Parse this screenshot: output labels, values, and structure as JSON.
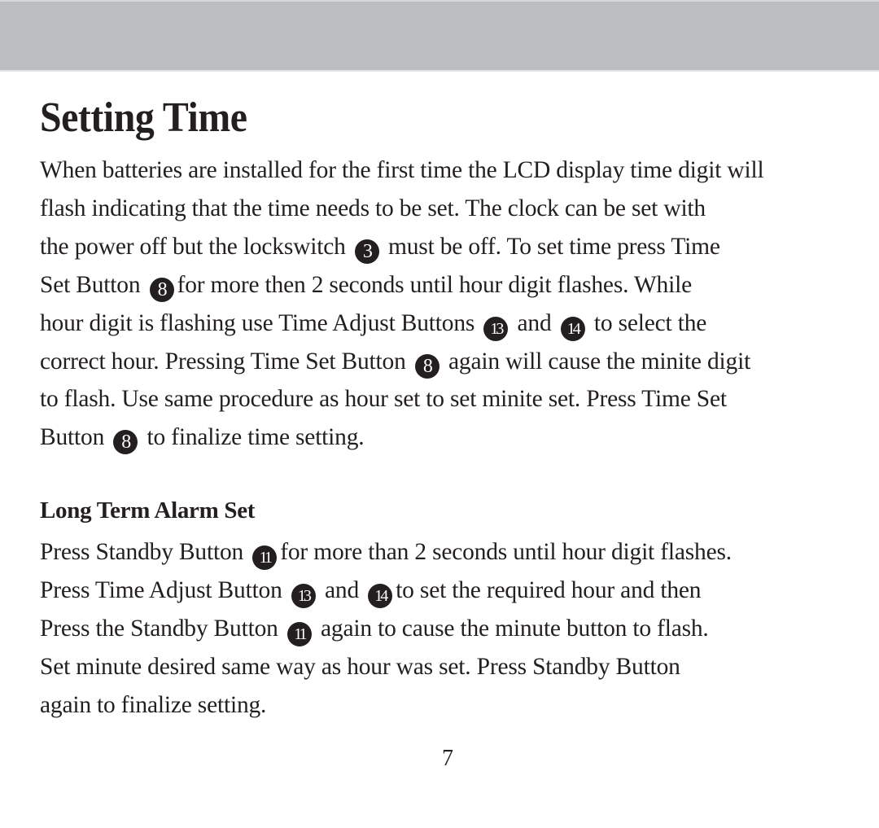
{
  "header": {
    "band_color": "#bcbdbf"
  },
  "title": "Setting Time",
  "setting_time": {
    "lines": [
      [
        "When batteries are installed for the first time the LCD display time digit will"
      ],
      [
        "flash indicating that the time needs to be set. The clock can be set with"
      ],
      [
        "the power off but the lockswitch ",
        "3",
        " must be off. To set time press Time"
      ],
      [
        "Set Button ",
        "8",
        "for more then 2 seconds until hour digit flashes. While"
      ],
      [
        "hour digit is flashing use Time Adjust Buttons ",
        "13",
        " and ",
        "14",
        " to select the"
      ],
      [
        "correct hour. Pressing Time Set Button ",
        "8",
        " again will cause the minite digit"
      ],
      [
        "to flash. Use same procedure as hour set to set minite set. Press Time Set"
      ],
      [
        "Button ",
        "8",
        " to finalize time setting."
      ]
    ]
  },
  "long_term_alarm": {
    "heading": "Long Term Alarm Set",
    "lines": [
      [
        "Press Standby Button ",
        "11",
        "for more than 2 seconds until hour digit flashes."
      ],
      [
        "Press Time Adjust Button ",
        "13",
        " and ",
        "14",
        "to set the required hour and then"
      ],
      [
        "Press the Standby Button ",
        "11",
        " again to cause the minute button to flash."
      ],
      [
        "Set minute desired same way as hour was set. Press Standby Button"
      ],
      [
        "again to finalize setting."
      ]
    ]
  },
  "page_number": "7"
}
